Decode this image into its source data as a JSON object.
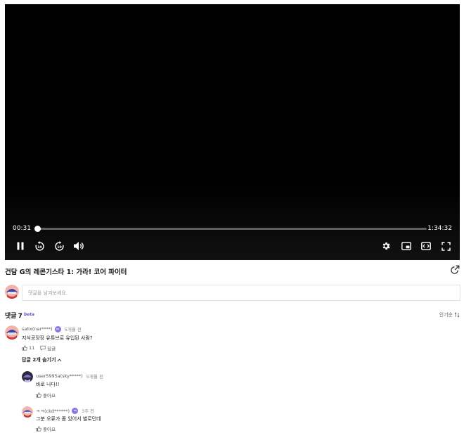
{
  "player": {
    "current_time": "00:31",
    "duration": "1:34:32",
    "progress": 0.0055
  },
  "video": {
    "title": "건담 G의 레콘기스타 1: 가라! 코어 파이터"
  },
  "composer": {
    "placeholder": "댓글을 남겨보세요."
  },
  "comments_header": {
    "label": "댓글",
    "count": "7",
    "beta": "beta",
    "sort_label": "인기순"
  },
  "comments": [
    {
      "user": "salix(nar****)",
      "ago": "5개월 전",
      "text": "지식공장장 유튜브로 유입된 사람?",
      "likes": "11",
      "reply_label": "답글"
    }
  ],
  "replies_toggle": "답글 2개 숨기기",
  "replies": [
    {
      "user": "user5995a(sky*****)",
      "ago": "5개월 전",
      "text": "바로 나다!!",
      "like_label": "좋아요"
    },
    {
      "user": "ㅋㅋ(ckd******)",
      "ago": "3주 전",
      "text": "그분 오류가 좀 있어서 별로던데",
      "like_label": "좋아요"
    }
  ],
  "colors": {
    "accent": "#8b74e4",
    "player_bg": "#000000"
  }
}
